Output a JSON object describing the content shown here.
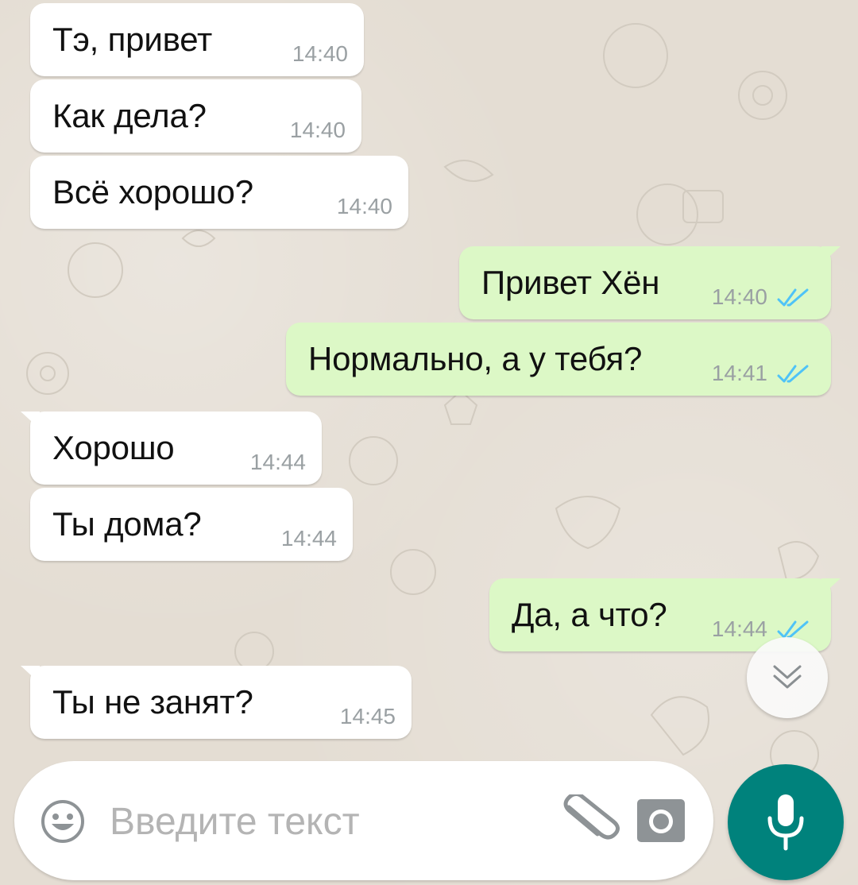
{
  "theme": {
    "incoming_color": "#ffffff",
    "outgoing_color": "#dcf8c6",
    "time_color": "#9aa0a3",
    "read_ticks_color": "#4fc3f7",
    "accent": "#00827c"
  },
  "messages": [
    {
      "direction": "in",
      "text": "Тэ, привет",
      "time": "14:40"
    },
    {
      "direction": "in",
      "text": "Как дела?",
      "time": "14:40"
    },
    {
      "direction": "in",
      "text": "Всё хорошо?",
      "time": "14:40"
    },
    {
      "direction": "out",
      "text": "Привет Хён",
      "time": "14:40",
      "status": "read"
    },
    {
      "direction": "out",
      "text": "Нормально, а у тебя?",
      "time": "14:41",
      "status": "read"
    },
    {
      "direction": "in",
      "text": "Хорошо",
      "time": "14:44"
    },
    {
      "direction": "in",
      "text": "Ты дома?",
      "time": "14:44"
    },
    {
      "direction": "out",
      "text": "Да, а что?",
      "time": "14:44",
      "status": "read"
    },
    {
      "direction": "in",
      "text": "Ты не занят?",
      "time": "14:45"
    }
  ],
  "composer": {
    "placeholder": "Введите текст",
    "value": "",
    "emoji_icon": "smiley-icon",
    "attach_icon": "paperclip-icon",
    "camera_icon": "camera-icon",
    "send_icon": "mic-icon"
  },
  "scroll_button": {
    "icon": "double-chevron-down-icon"
  }
}
